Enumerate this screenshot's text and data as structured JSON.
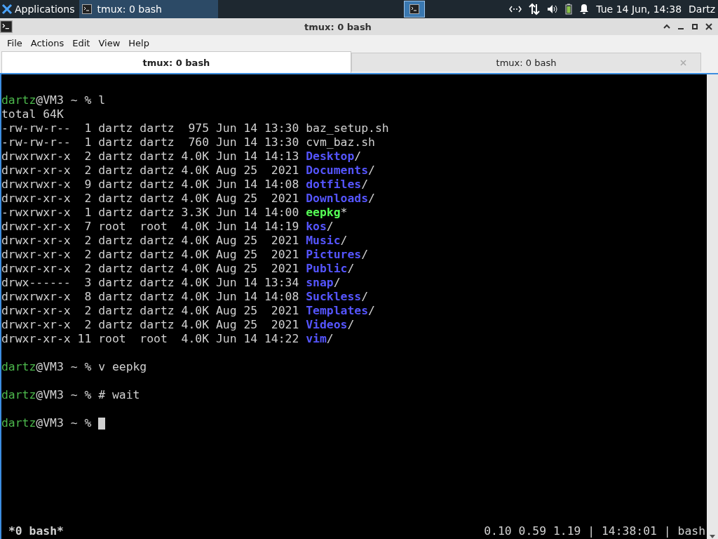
{
  "panel": {
    "apps_menu": "Applications",
    "tasks": [
      {
        "label": "tmux: 0 bash",
        "selected": true
      }
    ],
    "clock": "Tue 14 Jun, 14:38",
    "user": "Dartz"
  },
  "window": {
    "title": "tmux: 0 bash"
  },
  "menu": [
    "File",
    "Actions",
    "Edit",
    "View",
    "Help"
  ],
  "tabs": [
    {
      "label": "tmux: 0 bash",
      "selected": true
    },
    {
      "label": "tmux: 0 bash",
      "selected": false
    }
  ],
  "terminal": {
    "lines": [
      {
        "kind": "blank"
      },
      {
        "kind": "prompt",
        "user": "dartz",
        "rest": "@VM3 ~ % ",
        "command": "l"
      },
      {
        "kind": "text",
        "text": "total 64K"
      },
      {
        "kind": "listing",
        "meta": "-rw-rw-r--  1 dartz dartz  975 Jun 14 13:30",
        "name": "baz_setup.sh",
        "color": "#d0d0d0",
        "bold": false
      },
      {
        "kind": "listing",
        "meta": "-rw-rw-r--  1 dartz dartz  760 Jun 14 13:30",
        "name": "cvm_baz.sh",
        "color": "#d0d0d0",
        "bold": false
      },
      {
        "kind": "listing",
        "meta": "drwxrwxr-x  2 dartz dartz 4.0K Jun 14 14:13",
        "name": "Desktop",
        "suffix": "/",
        "color": "#5555ff",
        "bold": true
      },
      {
        "kind": "listing",
        "meta": "drwxr-xr-x  2 dartz dartz 4.0K Aug 25  2021",
        "name": "Documents",
        "suffix": "/",
        "color": "#5555ff",
        "bold": true
      },
      {
        "kind": "listing",
        "meta": "drwxrwxr-x  9 dartz dartz 4.0K Jun 14 14:08",
        "name": "dotfiles",
        "suffix": "/",
        "color": "#5555ff",
        "bold": true
      },
      {
        "kind": "listing",
        "meta": "drwxr-xr-x  2 dartz dartz 4.0K Aug 25  2021",
        "name": "Downloads",
        "suffix": "/",
        "color": "#5555ff",
        "bold": true
      },
      {
        "kind": "listing",
        "meta": "-rwxrwxr-x  1 dartz dartz 3.3K Jun 14 14:00",
        "name": "eepkg",
        "suffix": "*",
        "color": "#55ff55",
        "bold": true
      },
      {
        "kind": "listing",
        "meta": "drwxr-xr-x  7 root  root  4.0K Jun 14 14:19",
        "name": "kos",
        "suffix": "/",
        "color": "#5555ff",
        "bold": true
      },
      {
        "kind": "listing",
        "meta": "drwxr-xr-x  2 dartz dartz 4.0K Aug 25  2021",
        "name": "Music",
        "suffix": "/",
        "color": "#5555ff",
        "bold": true
      },
      {
        "kind": "listing",
        "meta": "drwxr-xr-x  2 dartz dartz 4.0K Aug 25  2021",
        "name": "Pictures",
        "suffix": "/",
        "color": "#5555ff",
        "bold": true
      },
      {
        "kind": "listing",
        "meta": "drwxr-xr-x  2 dartz dartz 4.0K Aug 25  2021",
        "name": "Public",
        "suffix": "/",
        "color": "#5555ff",
        "bold": true
      },
      {
        "kind": "listing",
        "meta": "drwx------  3 dartz dartz 4.0K Jun 14 13:34",
        "name": "snap",
        "suffix": "/",
        "color": "#5555ff",
        "bold": true
      },
      {
        "kind": "listing",
        "meta": "drwxrwxr-x  8 dartz dartz 4.0K Jun 14 14:08",
        "name": "Suckless",
        "suffix": "/",
        "color": "#5555ff",
        "bold": true
      },
      {
        "kind": "listing",
        "meta": "drwxr-xr-x  2 dartz dartz 4.0K Aug 25  2021",
        "name": "Templates",
        "suffix": "/",
        "color": "#5555ff",
        "bold": true
      },
      {
        "kind": "listing",
        "meta": "drwxr-xr-x  2 dartz dartz 4.0K Aug 25  2021",
        "name": "Videos",
        "suffix": "/",
        "color": "#5555ff",
        "bold": true
      },
      {
        "kind": "listing",
        "meta": "drwxr-xr-x 11 root  root  4.0K Jun 14 14:22",
        "name": "vim",
        "suffix": "/",
        "color": "#5555ff",
        "bold": true
      },
      {
        "kind": "blank"
      },
      {
        "kind": "prompt",
        "user": "dartz",
        "rest": "@VM3 ~ % ",
        "command": "v eepkg"
      },
      {
        "kind": "blank"
      },
      {
        "kind": "prompt",
        "user": "dartz",
        "rest": "@VM3 ~ % ",
        "command": "# wait"
      },
      {
        "kind": "blank"
      },
      {
        "kind": "prompt",
        "user": "dartz",
        "rest": "@VM3 ~ % ",
        "cursor": true
      }
    ]
  },
  "status_bar": {
    "window": "*0 bash*",
    "info": "0.10 0.59 1.19 | 14:38:01 | bash"
  }
}
